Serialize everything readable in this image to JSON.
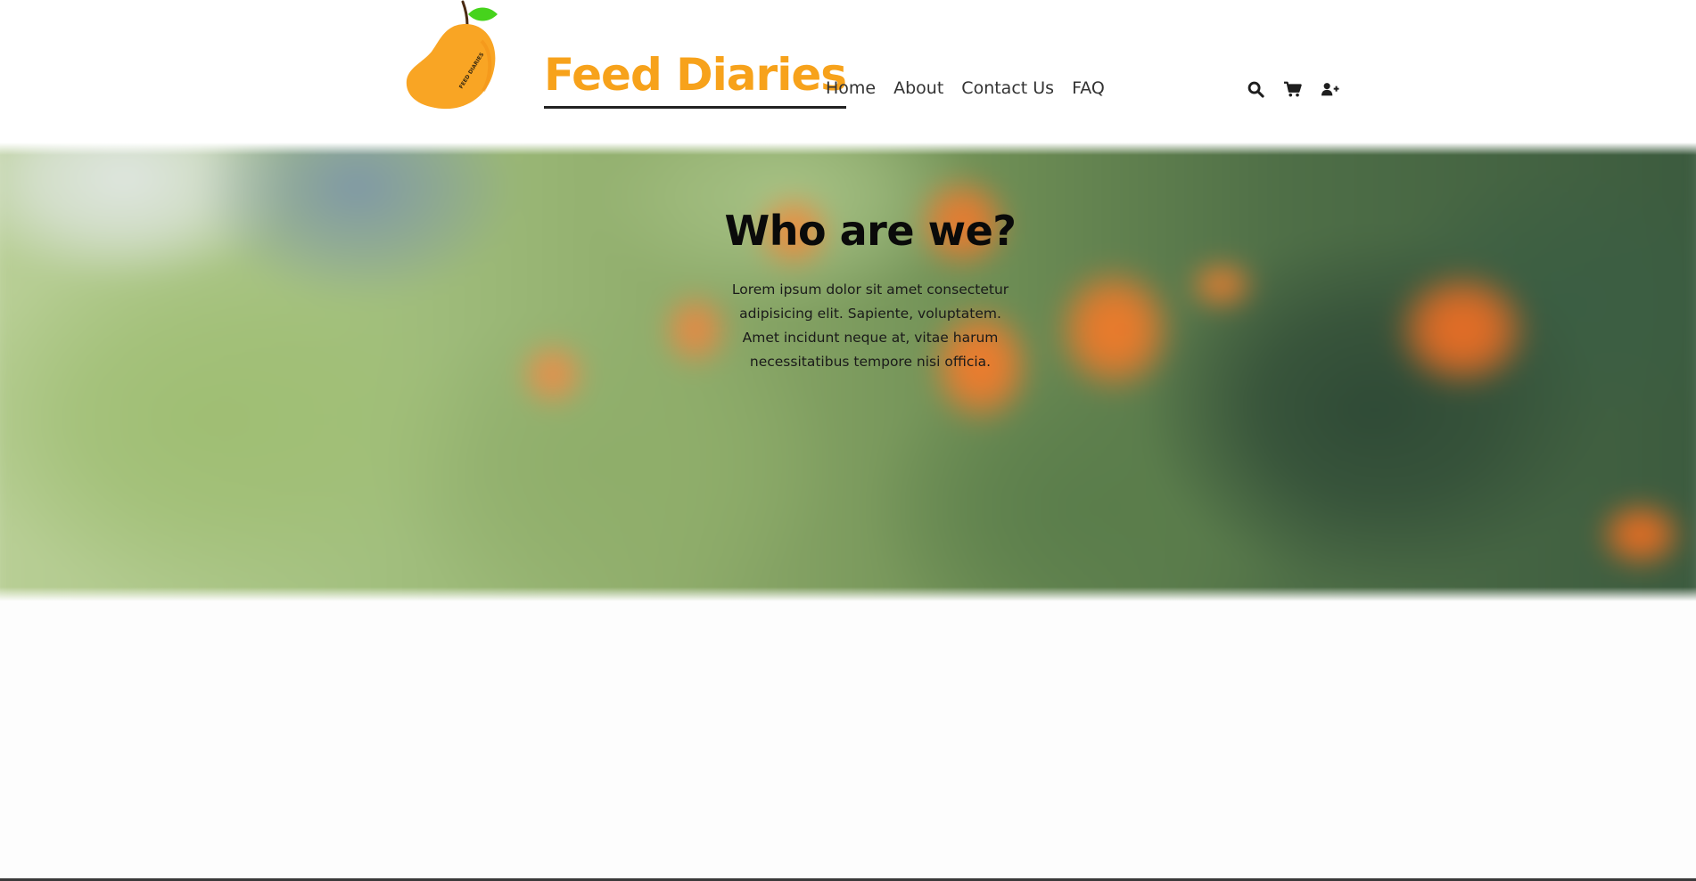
{
  "header": {
    "brand_name": "Feed Diaries",
    "brand_color": "#f7a21b",
    "logo_text": "FEED DIARIES",
    "nav": [
      {
        "label": "Home"
      },
      {
        "label": "About"
      },
      {
        "label": "Contact Us"
      },
      {
        "label": "FAQ"
      }
    ],
    "icons": [
      "search-icon",
      "cart-icon",
      "user-plus-icon"
    ]
  },
  "hero": {
    "title": "Who are we?",
    "text": "Lorem ipsum dolor sit amet consectetur adipisicing elit. Sapiente, voluptatem. Amet incidunt neque at, vitae harum necessitatibus tempore nisi officia."
  }
}
